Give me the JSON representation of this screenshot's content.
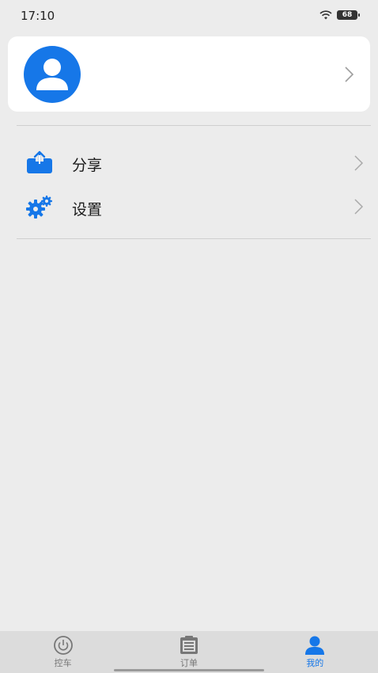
{
  "status_bar": {
    "time": "17:10",
    "battery": "68"
  },
  "profile": {
    "name": "",
    "avatar_icon": "user-avatar-icon"
  },
  "menu": {
    "items": [
      {
        "label": "分享",
        "icon": "share-upload-icon"
      },
      {
        "label": "设置",
        "icon": "settings-gears-icon"
      }
    ]
  },
  "tab_bar": {
    "tabs": [
      {
        "label": "控车",
        "icon": "power-icon",
        "active": false
      },
      {
        "label": "订单",
        "icon": "clipboard-icon",
        "active": false
      },
      {
        "label": "我的",
        "icon": "person-icon",
        "active": true
      }
    ]
  },
  "colors": {
    "accent": "#1677e8",
    "background": "#ececec",
    "card": "#ffffff",
    "tab_bar": "#dcdcdc"
  }
}
